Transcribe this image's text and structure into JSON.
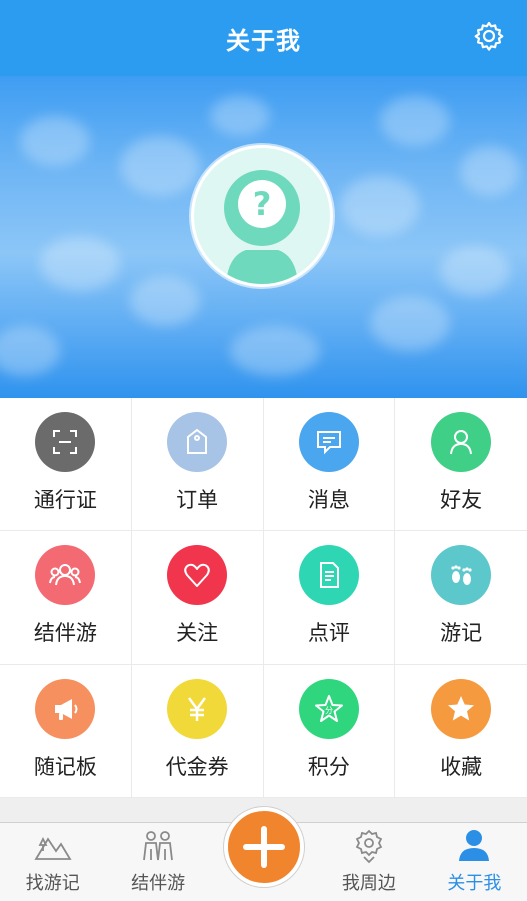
{
  "header": {
    "title": "关于我"
  },
  "menu": [
    {
      "label": "通行证",
      "icon": "id-scan-icon",
      "color": "#6b6b6b"
    },
    {
      "label": "订单",
      "icon": "tag-icon",
      "color": "#a7c3e6"
    },
    {
      "label": "消息",
      "icon": "message-icon",
      "color": "#4aa6ee"
    },
    {
      "label": "好友",
      "icon": "person-icon",
      "color": "#3fcf86"
    },
    {
      "label": "结伴游",
      "icon": "group-icon",
      "color": "#f36a73"
    },
    {
      "label": "关注",
      "icon": "heart-icon",
      "color": "#f0354c"
    },
    {
      "label": "点评",
      "icon": "document-icon",
      "color": "#2fd6b4"
    },
    {
      "label": "游记",
      "icon": "footprints-icon",
      "color": "#5cc8cc"
    },
    {
      "label": "随记板",
      "icon": "megaphone-icon",
      "color": "#f7905f"
    },
    {
      "label": "代金券",
      "icon": "yen-icon",
      "color": "#f2d93a"
    },
    {
      "label": "积分",
      "icon": "star-points-icon",
      "color": "#2fd67e"
    },
    {
      "label": "收藏",
      "icon": "star-icon",
      "color": "#f59a3e"
    }
  ],
  "tabbar": {
    "items": [
      {
        "label": "找游记",
        "icon": "mountain-icon"
      },
      {
        "label": "结伴游",
        "icon": "people-icon"
      },
      {
        "label": "",
        "icon": "plus-icon"
      },
      {
        "label": "我周边",
        "icon": "location-gear-icon"
      },
      {
        "label": "关于我",
        "icon": "user-icon",
        "active": true
      }
    ]
  }
}
